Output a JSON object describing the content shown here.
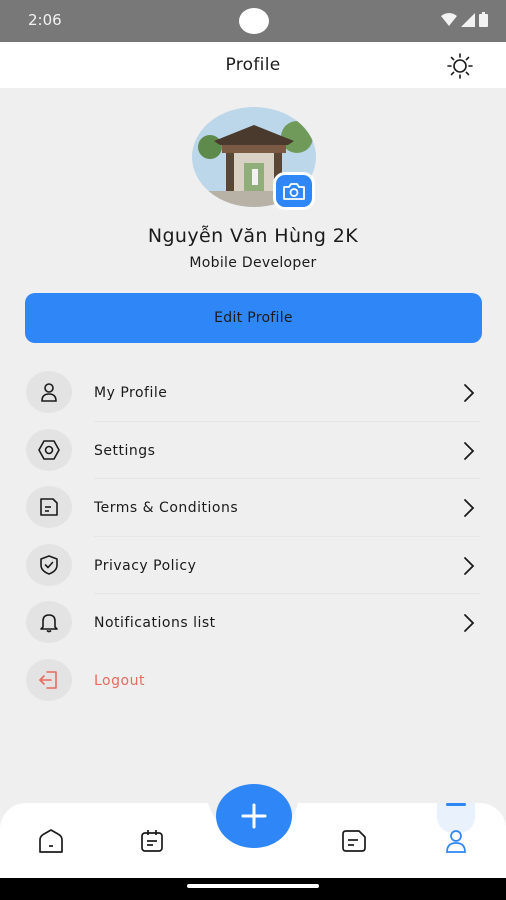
{
  "status": {
    "time": "2:06"
  },
  "header": {
    "title": "Profile"
  },
  "profile": {
    "name": "Nguyễn Văn Hùng 2K",
    "role": "Mobile Developer"
  },
  "edit_button": {
    "label": "Edit Profile"
  },
  "menu": {
    "items": [
      {
        "label": "My Profile",
        "icon": "user-icon"
      },
      {
        "label": "Settings",
        "icon": "gear-icon"
      },
      {
        "label": "Terms & Conditions",
        "icon": "document-icon"
      },
      {
        "label": "Privacy Policy",
        "icon": "shield-icon"
      },
      {
        "label": "Notifications list",
        "icon": "bell-icon"
      },
      {
        "label": "Logout",
        "icon": "logout-icon"
      }
    ]
  },
  "bottom_nav": {
    "items": [
      "home-icon",
      "calendar-icon",
      "add-icon",
      "notes-icon",
      "profile-icon"
    ],
    "active": "profile-icon"
  },
  "colors": {
    "accent": "#2f86f6",
    "danger": "#e86b5f",
    "background": "#efefef"
  }
}
